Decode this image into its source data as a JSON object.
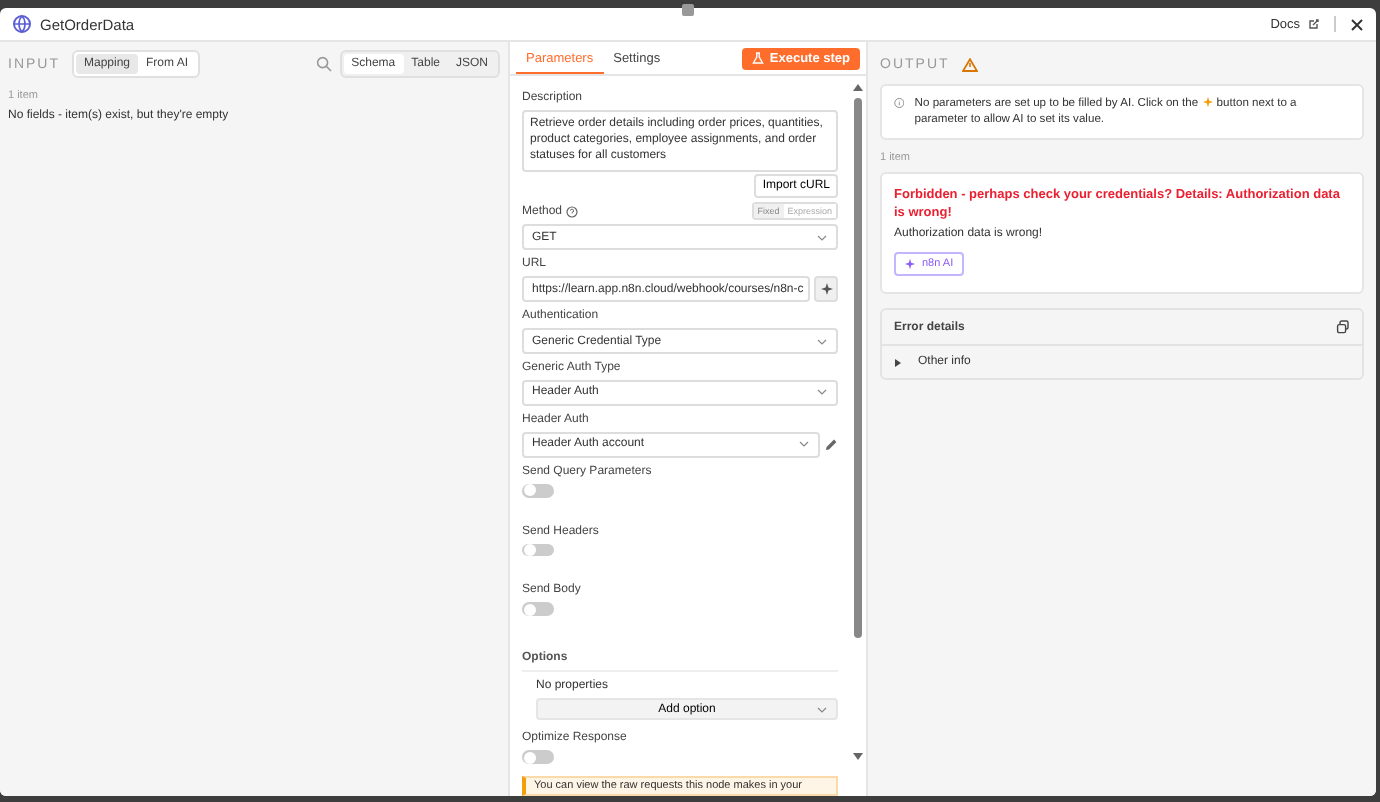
{
  "window": {
    "title": "GetOrderData",
    "docs_link": "Docs"
  },
  "input": {
    "label": "INPUT",
    "mode_tabs": [
      {
        "label": "Mapping",
        "selected": true
      },
      {
        "label": "From AI",
        "selected": false
      }
    ],
    "view_tabs": [
      {
        "label": "Schema",
        "selected": true
      },
      {
        "label": "Table",
        "selected": false
      },
      {
        "label": "JSON",
        "selected": false
      }
    ],
    "item_count": "1 item",
    "message": "No fields - item(s) exist, but they're empty"
  },
  "parameters": {
    "tabs": [
      {
        "label": "Parameters",
        "selected": true
      },
      {
        "label": "Settings",
        "selected": false
      }
    ],
    "execute_button": "Execute step",
    "description": {
      "label": "Description",
      "value": "Retrieve order details including order prices, quantities, product categories, employee assignments, and order statuses for all customers"
    },
    "import_button": "Import cURL",
    "method": {
      "label": "Method",
      "mode_tabs": [
        {
          "label": "Fixed",
          "selected": true
        },
        {
          "label": "Expression",
          "selected": false
        }
      ],
      "value": "GET"
    },
    "fields": [
      {
        "kind": "url",
        "label": "URL",
        "value": "https://learn.app.n8n.cloud/webhook/courses/n8n-c"
      },
      {
        "kind": "select",
        "label": "Authentication",
        "value": "Generic Credential Type"
      },
      {
        "kind": "select",
        "label": "Generic Auth Type",
        "value": "Header Auth"
      },
      {
        "kind": "credential",
        "label": "Header Auth",
        "value": "Header Auth account"
      },
      {
        "kind": "toggle",
        "label": "Send Query Parameters",
        "on": false
      },
      {
        "kind": "toggle",
        "label": "Send Headers",
        "on": false
      },
      {
        "kind": "toggle",
        "label": "Send Body",
        "on": false
      },
      {
        "kind": "options",
        "label": "Options",
        "empty": "No properties",
        "add_button": "Add option"
      },
      {
        "kind": "toggle",
        "label": "Optimize Response",
        "on": false
      }
    ],
    "banner": "You can view the raw requests this node makes in your"
  },
  "output": {
    "label": "OUTPUT",
    "notice_before": "No parameters are set up to be filled by AI. Click on the",
    "notice_after": "button next to a parameter to allow AI to set its value.",
    "item_count": "1 item",
    "error_title": "Forbidden - perhaps check your credentials? Details: Authorization data is wrong!",
    "error_message": "Authorization data is wrong!",
    "ai_button": "n8n AI",
    "error_details": {
      "title": "Error details",
      "rows": [
        {
          "label": "Other info",
          "expanded": false
        }
      ]
    }
  }
}
